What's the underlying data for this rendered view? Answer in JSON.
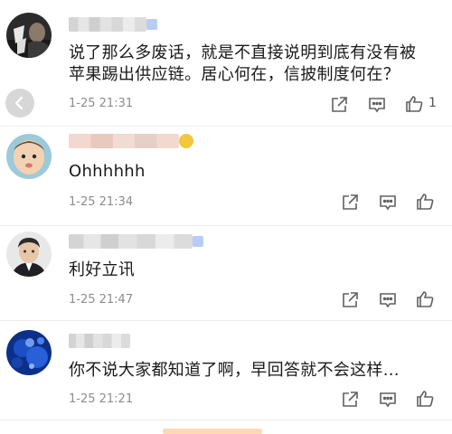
{
  "comments": [
    {
      "text": "说了那么多废话，就是不直接说明到底有没有被苹果踢出供应链。居心何在，信披制度何在？",
      "time": "1-25 21:31",
      "likes": "1"
    },
    {
      "text": "Ohhhhhh",
      "time": "1-25 21:34",
      "likes": ""
    },
    {
      "text": "利好立讯",
      "time": "1-25 21:47",
      "likes": ""
    },
    {
      "text": "你不说大家都知道了啊，早回答就不会这样...",
      "time": "1-25 21:21",
      "likes": ""
    }
  ],
  "icons": {
    "share": "share-icon",
    "comment": "comment-icon",
    "like": "thumbs-up-icon",
    "back": "chevron-left-icon"
  },
  "colors": {
    "text": "#1a1a1a",
    "meta": "#8c8c8c",
    "icon": "#606060",
    "divider": "#ececec"
  }
}
